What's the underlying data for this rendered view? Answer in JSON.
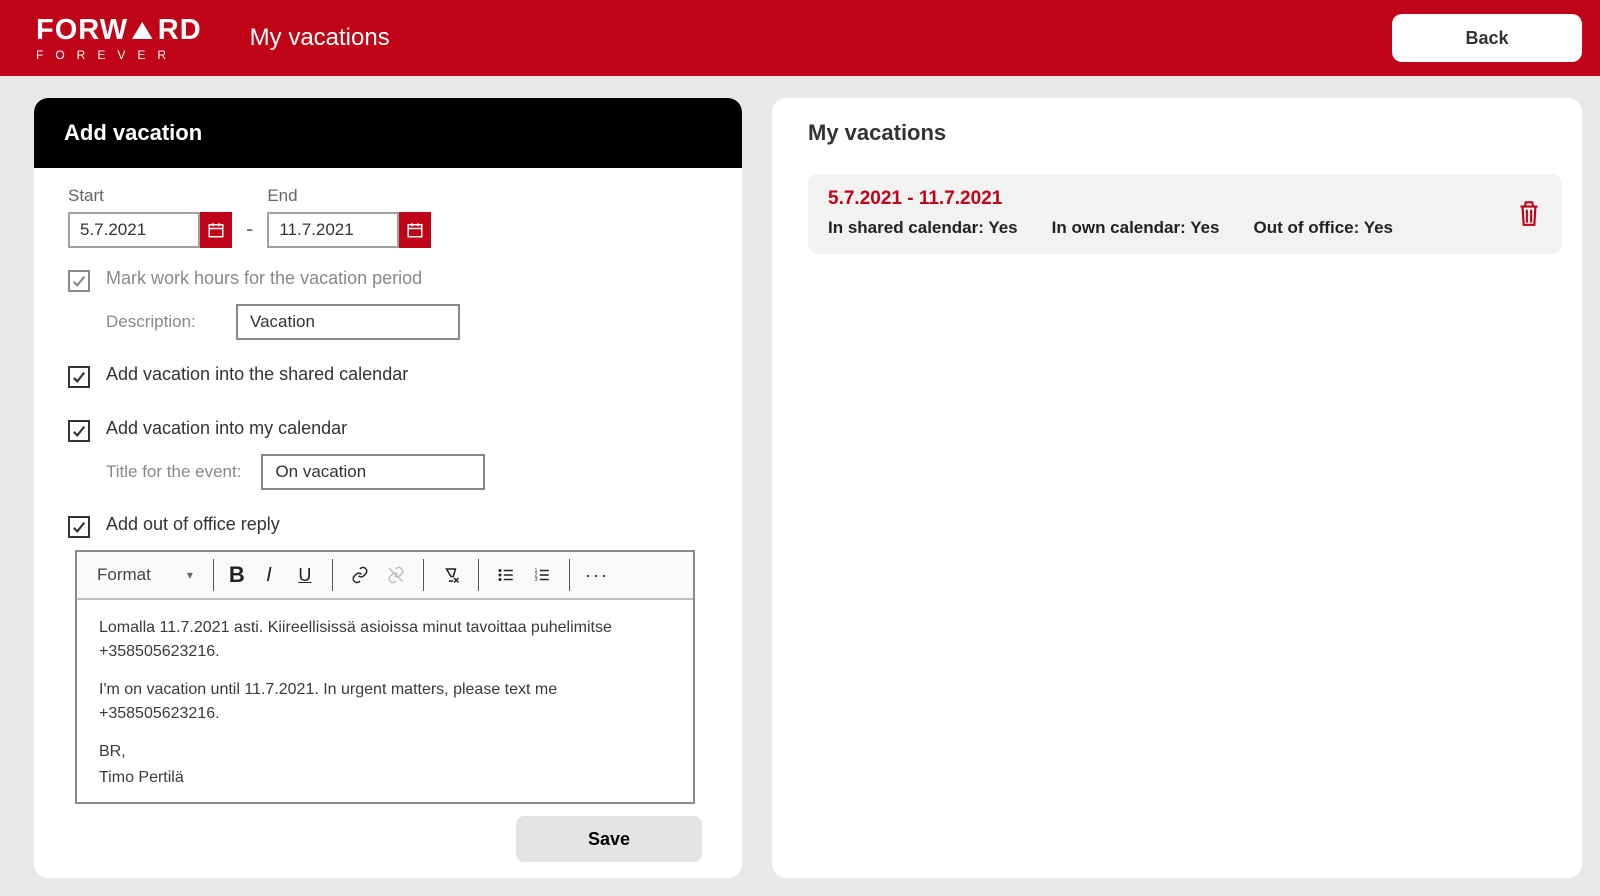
{
  "brand": {
    "main": "FORWARD",
    "sub": "FOREVER"
  },
  "header": {
    "title": "My vacations",
    "back_label": "Back"
  },
  "left_panel": {
    "title": "Add vacation",
    "start_label": "Start",
    "end_label": "End",
    "start_value": "5.7.2021",
    "end_value": "11.7.2021",
    "mark_hours_label": "Mark work hours for the vacation period",
    "description_label": "Description:",
    "description_value": "Vacation",
    "shared_cal_label": "Add vacation into the shared calendar",
    "my_cal_label": "Add vacation into my calendar",
    "event_title_label": "Title for the event:",
    "event_title_value": "On vacation",
    "ooo_label": "Add out of office reply",
    "editor": {
      "format_label": "Format",
      "body_p1": "Lomalla 11.7.2021 asti. Kiireellisissä asioissa minut tavoittaa puhelimitse +358505623216.",
      "body_p2": "I'm on vacation until 11.7.2021. In urgent matters, please text me +358505623216.",
      "body_p3": "BR,",
      "body_p4": "Timo Pertilä"
    },
    "save_label": "Save"
  },
  "right_panel": {
    "title": "My vacations",
    "items": [
      {
        "date_range": "5.7.2021 - 11.7.2021",
        "shared_label": "In shared calendar:",
        "shared_value": "Yes",
        "own_label": "In own calendar:",
        "own_value": "Yes",
        "ooo_label": "Out of office:",
        "ooo_value": "Yes"
      }
    ]
  }
}
